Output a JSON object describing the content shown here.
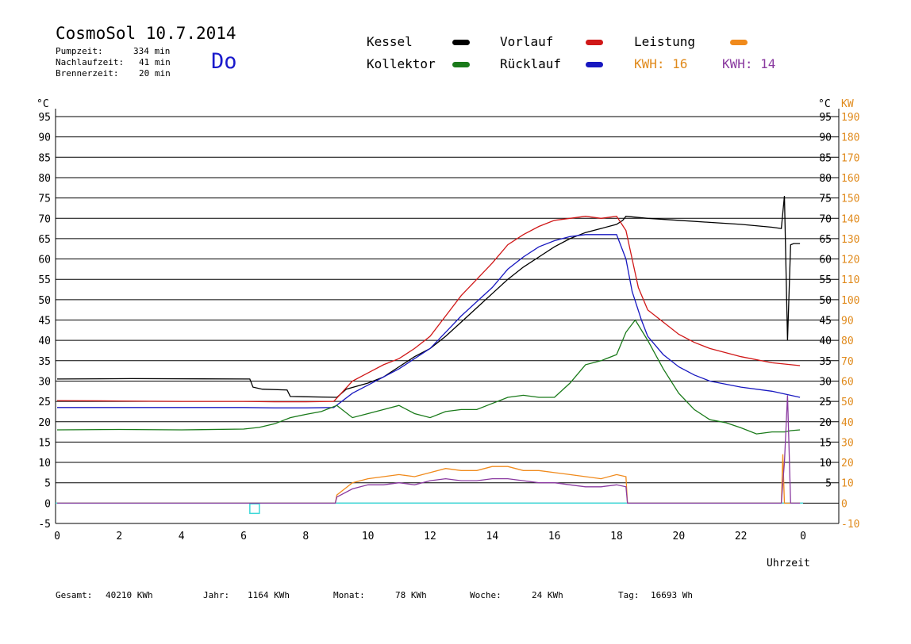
{
  "header": {
    "title": "CosmoSol 10.7.2014",
    "weekday": "Do",
    "pump_label": "Pumpzeit:",
    "pump_value": "334 min",
    "nachlauf_label": "Nachlaufzeit:",
    "nachlauf_value": "41 min",
    "brenner_label": "Brennerzeit:",
    "brenner_value": "20 min"
  },
  "legend": {
    "kessel": "Kessel",
    "kollektor": "Kollektor",
    "vorlauf": "Vorlauf",
    "ruecklauf": "Rücklauf",
    "leistung": "Leistung",
    "kwh1": "KWH: 16",
    "kwh2": "KWH: 14"
  },
  "footer": {
    "gesamt_label": "Gesamt:",
    "gesamt_value": "40210 KWh",
    "jahr_label": "Jahr:",
    "jahr_value": "1164 KWh",
    "monat_label": "Monat:",
    "monat_value": "78 KWh",
    "woche_label": "Woche:",
    "woche_value": "24 KWh",
    "tag_label": "Tag:",
    "tag_value": "16693 Wh"
  },
  "colors": {
    "kessel": "#000000",
    "kollektor": "#1a7a1a",
    "vorlauf": "#d01818",
    "ruecklauf": "#1818c0",
    "leistung": "#f08a1c",
    "kwh2": "#8a3aa0",
    "baseline": "#3cd8d8"
  },
  "chart_data": {
    "type": "line",
    "xlabel": "Uhrzeit",
    "ylabel_left": "°C",
    "ylabel_right": "KW",
    "xlim": [
      0,
      24
    ],
    "ylim": [
      -5,
      95
    ],
    "y2lim": [
      -10,
      190
    ],
    "x_ticks": [
      "0",
      "2",
      "4",
      "6",
      "8",
      "10",
      "12",
      "14",
      "16",
      "18",
      "20",
      "22",
      "0"
    ],
    "y_ticks": [
      -5,
      0,
      5,
      10,
      15,
      20,
      25,
      30,
      35,
      40,
      45,
      50,
      55,
      60,
      65,
      70,
      75,
      80,
      85,
      90,
      95
    ],
    "y2_ticks": [
      -10,
      0,
      10,
      20,
      30,
      40,
      50,
      60,
      70,
      80,
      90,
      100,
      110,
      120,
      130,
      140,
      150,
      160,
      170,
      180,
      190
    ],
    "y_ticks_right": [
      5,
      10,
      15,
      20,
      25,
      30,
      35,
      40,
      45,
      50,
      55,
      60,
      65,
      70,
      75,
      80,
      85,
      90,
      95
    ],
    "grid": true,
    "series": [
      {
        "name": "Kessel",
        "x": [
          0,
          2.4,
          6.2,
          6.3,
          6.6,
          7.4,
          7.5,
          9.0,
          9.3,
          10.0,
          10.5,
          11.0,
          11.5,
          12.0,
          12.5,
          13.0,
          13.5,
          14.0,
          14.5,
          15.0,
          15.5,
          16.0,
          16.5,
          17.0,
          17.5,
          18.0,
          18.2,
          18.3,
          19.0,
          20.0,
          21.0,
          22.0,
          23.0,
          23.3,
          23.4,
          23.5,
          23.6,
          23.7,
          23.9
        ],
        "values": [
          30.5,
          30.6,
          30.5,
          28.5,
          28.0,
          27.8,
          26.2,
          26.0,
          28.0,
          29.5,
          31.0,
          33.5,
          36.0,
          38.0,
          41.0,
          44.5,
          48.0,
          51.5,
          55.0,
          58.0,
          60.5,
          63.0,
          65.0,
          66.5,
          67.5,
          68.5,
          69.5,
          70.5,
          70.0,
          69.5,
          69.0,
          68.5,
          67.8,
          67.5,
          75.5,
          40.0,
          63.5,
          63.8,
          63.8
        ]
      },
      {
        "name": "Vorlauf",
        "x": [
          0,
          2,
          4,
          6,
          7,
          8,
          8.9,
          9.5,
          10.0,
          10.5,
          11.0,
          11.5,
          12.0,
          12.5,
          13.0,
          13.5,
          14.0,
          14.5,
          15.0,
          15.5,
          16.0,
          16.5,
          17.0,
          17.5,
          18.0,
          18.3,
          18.5,
          18.7,
          19.0,
          19.5,
          20.0,
          20.5,
          21.0,
          22.0,
          23.0,
          23.9
        ],
        "values": [
          25.2,
          25.1,
          25.0,
          25.0,
          24.9,
          24.9,
          25.0,
          30.0,
          32.0,
          34.0,
          35.5,
          38.0,
          41.0,
          46.0,
          51.0,
          55.0,
          59.0,
          63.5,
          66.0,
          68.0,
          69.5,
          70.0,
          70.5,
          70.0,
          70.5,
          67.0,
          60.0,
          53.0,
          47.5,
          44.5,
          41.5,
          39.5,
          38.0,
          36.0,
          34.5,
          33.8
        ]
      },
      {
        "name": "Rücklauf",
        "x": [
          0,
          2,
          4,
          6,
          7,
          8,
          8.9,
          9.5,
          10.0,
          10.5,
          11.0,
          11.5,
          12.0,
          12.5,
          13.0,
          13.5,
          14.0,
          14.5,
          15.0,
          15.5,
          16.0,
          16.5,
          17.0,
          17.5,
          18.0,
          18.3,
          18.5,
          18.8,
          19.0,
          19.5,
          20.0,
          20.5,
          21.0,
          22.0,
          23.0,
          23.9
        ],
        "values": [
          23.5,
          23.5,
          23.5,
          23.5,
          23.4,
          23.4,
          23.5,
          27.0,
          29.0,
          31.0,
          33.0,
          35.5,
          38.0,
          42.0,
          46.0,
          49.5,
          53.0,
          57.5,
          60.5,
          63.0,
          64.5,
          65.5,
          66.0,
          66.0,
          66.0,
          60.0,
          52.0,
          45.0,
          41.0,
          36.5,
          33.5,
          31.5,
          30.0,
          28.5,
          27.5,
          26.0
        ]
      },
      {
        "name": "Kollektor",
        "x": [
          0,
          2,
          4,
          6,
          6.5,
          7,
          7.5,
          8,
          8.5,
          9.0,
          9.5,
          10.0,
          10.5,
          11.0,
          11.5,
          12.0,
          12.5,
          13.0,
          13.5,
          14.0,
          14.5,
          15.0,
          15.5,
          16.0,
          16.5,
          17.0,
          17.5,
          18.0,
          18.3,
          18.6,
          19.0,
          19.5,
          20.0,
          20.5,
          21.0,
          21.5,
          22.0,
          22.5,
          23.0,
          23.4,
          23.6,
          23.9
        ],
        "values": [
          18.0,
          18.1,
          18.0,
          18.2,
          18.6,
          19.5,
          21.0,
          21.8,
          22.5,
          24.0,
          21.0,
          22.0,
          23.0,
          24.0,
          22.0,
          21.0,
          22.5,
          23.0,
          23.0,
          24.5,
          26.0,
          26.5,
          26.0,
          26.0,
          29.5,
          34.0,
          35.0,
          36.5,
          42.0,
          45.0,
          40.0,
          33.0,
          27.0,
          23.0,
          20.5,
          19.8,
          18.5,
          17.0,
          17.5,
          17.5,
          17.8,
          18.0
        ]
      },
      {
        "name": "Leistung",
        "x": [
          0,
          8.95,
          9.0,
          9.5,
          10.0,
          10.5,
          11.0,
          11.5,
          12.0,
          12.5,
          13.0,
          13.5,
          14.0,
          14.5,
          15.0,
          15.5,
          16.0,
          16.5,
          17.0,
          17.5,
          18.0,
          18.3,
          18.35,
          23.3,
          23.35,
          23.4,
          23.9
        ],
        "values": [
          0,
          0,
          4,
          10,
          12,
          13,
          14,
          13,
          15,
          17,
          16,
          16,
          18,
          18,
          16,
          16,
          15,
          14,
          13,
          12,
          14,
          13,
          0,
          0,
          24,
          0,
          0
        ]
      },
      {
        "name": "KWH 14",
        "x": [
          0,
          8.95,
          9.0,
          9.5,
          10.0,
          10.5,
          11.0,
          11.5,
          12.0,
          12.5,
          13.0,
          13.5,
          14.0,
          14.5,
          15.0,
          15.5,
          16.0,
          16.5,
          17.0,
          17.5,
          18.0,
          18.3,
          18.35,
          23.3,
          23.4,
          23.5,
          23.6,
          23.9
        ],
        "values": [
          0,
          0,
          3,
          7,
          9,
          9,
          10,
          9,
          11,
          12,
          11,
          11,
          12,
          12,
          11,
          10,
          10,
          9,
          8,
          8,
          9,
          8,
          0,
          0,
          20,
          53,
          0,
          0
        ]
      }
    ]
  }
}
